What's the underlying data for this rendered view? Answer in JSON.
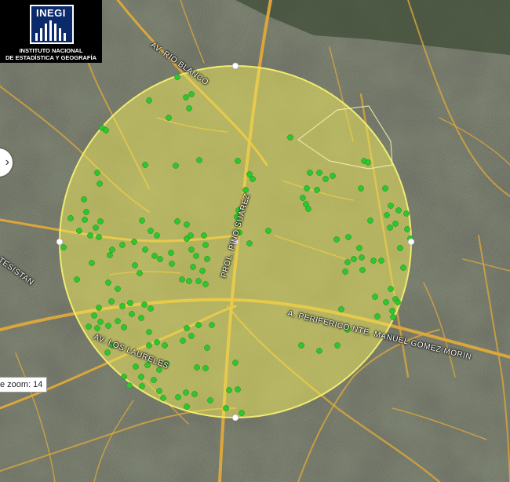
{
  "logo": {
    "name": "INEGI",
    "line1": "INSTITUTO NACIONAL",
    "line2": "DE ESTADÍSTICA Y GEOGRAFÍA"
  },
  "zoom_label": "e zoom: 14",
  "streets": [
    {
      "text": "AV. RIO BLANCO"
    },
    {
      "text": "PROL. PINO SUAREZ"
    },
    {
      "text": "A. PERIFERICO NTE. MANUEL GOMEZ MORIN"
    },
    {
      "text": "TESISTAN"
    },
    {
      "text": "AV. LOS LAURELES"
    }
  ],
  "buffer": {
    "fill_color": "#f3ee5a",
    "stroke_color": "#f0ec70",
    "handle_color": "#ffffff"
  },
  "points": {
    "color": "#2ec62e"
  },
  "colors": {
    "road": "#e0a93a",
    "imagery": "#4a4e40"
  },
  "icons": {
    "nav": "chevron-right-icon"
  }
}
